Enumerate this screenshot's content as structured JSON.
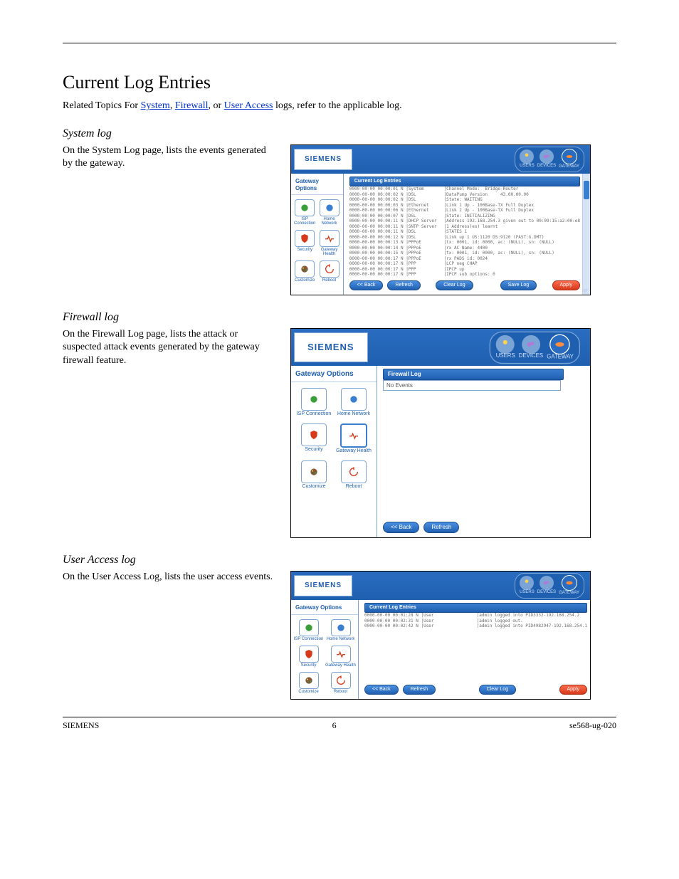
{
  "doc": {
    "title": "Current Log Entries",
    "linksLabel": "Related Topics For",
    "link1": "System",
    "link2": "Firewall",
    "sep": ", or ",
    "link3": "User Access",
    "tail": " logs, refer to the applicable log."
  },
  "sections": {
    "s1": {
      "title": "System log",
      "body": "On the System Log page, lists the events generated by the gateway."
    },
    "s2": {
      "title": "Firewall log",
      "body": "On the Firewall Log page, lists the attack or suspected attack events generated by the gateway firewall feature."
    },
    "s3": {
      "title": "User Access log",
      "body": "On the User Access Log, lists the user access events."
    }
  },
  "ui": {
    "brand": "SIEMENS",
    "tabs": {
      "users": "USERS",
      "devices": "DEVICES",
      "gateway": "GATEWAY"
    },
    "sideTitle": "Gateway Options",
    "sideItems": [
      "ISP\nConnection",
      "Home\nNetwork",
      "Security",
      "Gateway\nHealth",
      "Customize",
      "Reboot"
    ],
    "btns": {
      "back": "<< Back",
      "refresh": "Refresh",
      "clear": "Clear Log",
      "save": "Save Log",
      "apply": "Apply"
    }
  },
  "shot1": {
    "hdr": "Current Log Entries",
    "left": "0000-00-00 00:00:01 N |System\n0000-00-00 00:00:02 N |DSL\n0000-00-00 00:00:02 N |DSL\n0000-00-00 00:00:03 N |Ethernet\n0000-00-00 00:00:06 N |Ethernet\n0000-00-00 00:00:07 N |DSL\n0000-00-00 00:00:11 N |DHCP Server\n0000-00-00 00:00:11 N |SNTP Server\n0000-00-00 00:00:11 N |DSL\n0000-00-00 00:00:12 N |DSL\n0000-00-00 00:00:13 N |PPPoE\n0000-00-00 00:00:14 N |PPPoE\n0000-00-00 00:00:15 N |PPPoE\n0000-00-00 00:00:17 N |PPPoE\n0000-00-00 00:00:17 N |PPP\n0000-00-00 00:00:17 N |PPP\n0000-00-00 00:00:17 N |PPP",
    "right": "|Channel Mode:  Bridge-Router\n|DataPump Version     43.00.00.00\n|State: WAITING\n|Link 1 Up - 100Base-TX Full Duplex\n|Link 2 Up - 100Base-TX Full Duplex\n|State: INITIALIZING\n|Address 192.168.254.3 given out to 00:09:15:a2:00:e8\n|1 Address(es) learnt\n|STATES 1\n|Link up 1 US:1120 DS:9120 (FAST:G.DMT)\n|tx: 0001, id: 0000, ac: (NULL), sn: (NULL)\n|rx AC Name: 4400\n|tx: 0001, id: 0000, ac: (NULL), sn: (NULL)\n|rx PADS id: 0024\n|LCP neg CHAP\n|IPCP up\n|IPCP sub options: 0"
  },
  "shot2": {
    "hdr": "Firewall Log",
    "body": "No Events"
  },
  "shot3": {
    "hdr": "Current Log Entries",
    "left": "0000-00-00 00:01:28 N |User\n0000-00-00 00:02:31 N |User\n0000-00-00 00:02:42 N |User",
    "right": "|admin logged into PID3332-192.168.254.2\n|admin logged out.\n|admin logged into PID4982947-192.168.254.1"
  },
  "footer": {
    "left": "SIEMENS",
    "center": "6",
    "right": "se568-ug-020"
  }
}
